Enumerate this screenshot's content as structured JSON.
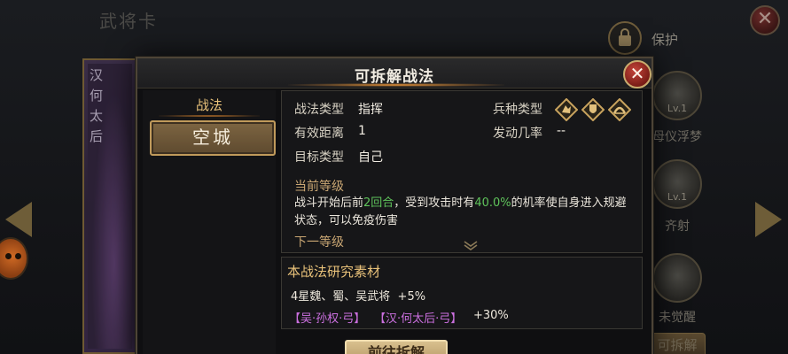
{
  "background": {
    "title": "武将卡",
    "lock_label": "保护",
    "card_text": "汉何太后",
    "skills": [
      {
        "level": "Lv.1",
        "name": "母仪浮梦"
      },
      {
        "level": "Lv.1",
        "name": "齐射"
      },
      {
        "level": "",
        "name": "未觉醒"
      }
    ],
    "split_button": "可拆解"
  },
  "modal": {
    "title": "可拆解战法",
    "close_glyph": "✕",
    "left": {
      "heading": "战法",
      "selected_tactic": "空城"
    },
    "details": {
      "type_label": "战法类型",
      "type_value": "指挥",
      "range_label": "有效距离",
      "range_value": "1",
      "target_label": "目标类型",
      "target_value": "自己",
      "troop_label": "兵种类型",
      "troop_icons": [
        "cavalry-icon",
        "shield-icon",
        "archer-icon"
      ],
      "rate_label": "发动几率",
      "rate_value": "--",
      "current_level_heading": "当前等级",
      "desc_part1": "战斗开始后前",
      "desc_rounds": "2回合",
      "desc_part2": "，受到攻击时有",
      "desc_rate": "40.0%",
      "desc_part3": "的机率使自身进入规避",
      "desc_line2": "状态，可以免疫伤害",
      "next_level_heading": "下一等级"
    },
    "materials": {
      "title": "本战法研究素材",
      "line1_text": "4星魏、蜀、吴武将",
      "line1_bonus": "+5%",
      "tag1": "【吴·孙权·弓】",
      "tag2": "【汉·何太后·弓】",
      "tags_bonus": "+30%"
    },
    "action_button": "前往拆解"
  },
  "colors": {
    "accent_gold": "#e9c27a",
    "highlight_green": "#5fc35b",
    "tag_purple": "#cc70e0"
  }
}
